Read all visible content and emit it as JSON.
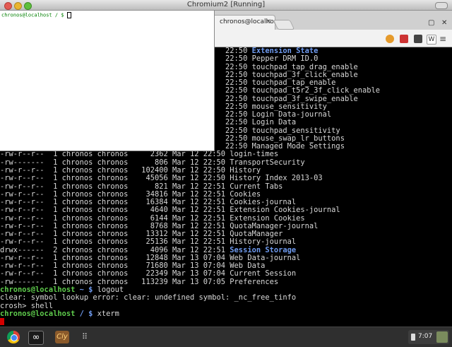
{
  "window": {
    "title": "Chromium2 [Running]"
  },
  "browser": {
    "tab_title": "chronos@localhost:/",
    "tab_close": "×"
  },
  "xterm": {
    "prompt": "chronos@localhost / $ "
  },
  "terminal": {
    "ls_lines": [
      {
        "prefix": "                                                   22:50 ",
        "name": "Extension State",
        "dir": true
      },
      {
        "prefix": "                                                   22:50 ",
        "name": "Pepper DRM ID.0",
        "dir": false
      },
      {
        "prefix": "                                                   22:50 ",
        "name": "touchpad_tap_drag_enable",
        "dir": false
      },
      {
        "prefix": "                                                   22:50 ",
        "name": "touchpad_3f_click_enable",
        "dir": false
      },
      {
        "prefix": "                                                   22:50 ",
        "name": "touchpad_tap_enable",
        "dir": false
      },
      {
        "prefix": "                                                   22:50 ",
        "name": "touchpad_t5r2_3f_click_enable",
        "dir": false
      },
      {
        "prefix": "                                                   22:50 ",
        "name": "touchpad_3f_swipe_enable",
        "dir": false
      },
      {
        "prefix": "                                                   22:50 ",
        "name": "mouse_sensitivity",
        "dir": false
      },
      {
        "prefix": "                                                   22:50 ",
        "name": "Login Data-journal",
        "dir": false
      },
      {
        "prefix": "                                                   22:50 ",
        "name": "Login Data",
        "dir": false
      },
      {
        "prefix": "                                                   22:50 ",
        "name": "touchpad_sensitivity",
        "dir": false
      },
      {
        "prefix": "                                                   22:50 ",
        "name": "mouse_swap_lr_buttons",
        "dir": false
      },
      {
        "prefix": "                                                   22:50 ",
        "name": "Managed Mode Settings",
        "dir": false
      },
      {
        "prefix": "-rw-r--r--  1 chronos chronos     2362 Mar 12 22:50 ",
        "name": "login-times",
        "dir": false
      },
      {
        "prefix": "-rw-------  1 chronos chronos      806 Mar 12 22:50 ",
        "name": "TransportSecurity",
        "dir": false
      },
      {
        "prefix": "-rw-r--r--  1 chronos chronos   102400 Mar 12 22:50 ",
        "name": "History",
        "dir": false
      },
      {
        "prefix": "-rw-r--r--  1 chronos chronos    45056 Mar 12 22:50 ",
        "name": "History Index 2013-03",
        "dir": false
      },
      {
        "prefix": "-rw-r--r--  1 chronos chronos      821 Mar 12 22:51 ",
        "name": "Current Tabs",
        "dir": false
      },
      {
        "prefix": "-rw-r--r--  1 chronos chronos    34816 Mar 12 22:51 ",
        "name": "Cookies",
        "dir": false
      },
      {
        "prefix": "-rw-r--r--  1 chronos chronos    16384 Mar 12 22:51 ",
        "name": "Cookies-journal",
        "dir": false
      },
      {
        "prefix": "-rw-r--r--  1 chronos chronos     4640 Mar 12 22:51 ",
        "name": "Extension Cookies-journal",
        "dir": false
      },
      {
        "prefix": "-rw-r--r--  1 chronos chronos     6144 Mar 12 22:51 ",
        "name": "Extension Cookies",
        "dir": false
      },
      {
        "prefix": "-rw-r--r--  1 chronos chronos     8768 Mar 12 22:51 ",
        "name": "QuotaManager-journal",
        "dir": false
      },
      {
        "prefix": "-rw-r--r--  1 chronos chronos    13312 Mar 12 22:51 ",
        "name": "QuotaManager",
        "dir": false
      },
      {
        "prefix": "-rw-r--r--  1 chronos chronos    25136 Mar 12 22:51 ",
        "name": "History-journal",
        "dir": false
      },
      {
        "prefix": "drwx------  2 chronos chronos     4096 Mar 12 22:51 ",
        "name": "Session Storage",
        "dir": true
      },
      {
        "prefix": "-rw-r--r--  1 chronos chronos    12848 Mar 13 07:04 ",
        "name": "Web Data-journal",
        "dir": false
      },
      {
        "prefix": "-rw-r--r--  1 chronos chronos    71680 Mar 13 07:04 ",
        "name": "Web Data",
        "dir": false
      },
      {
        "prefix": "-rw-r--r--  1 chronos chronos    22349 Mar 13 07:04 ",
        "name": "Current Session",
        "dir": false
      },
      {
        "prefix": "-rw-------  1 chronos chronos   113239 Mar 13 07:05 ",
        "name": "Preferences",
        "dir": false
      }
    ],
    "prompt_host": "chronos@localhost",
    "prompt_path": " ~ $ ",
    "cmd_logout": "logout",
    "error_line": "clear: symbol lookup error: clear: undefined symbol: _nc_free_tinfo",
    "crosh_prompt": "crosh> shell",
    "prompt_path_root": " / $ ",
    "cmd_xterm": "xterm"
  },
  "shelf": {
    "infinity_glyph": "∞",
    "cly_label": "Cly",
    "apps_glyph": "⠿",
    "clock": "7:07"
  }
}
